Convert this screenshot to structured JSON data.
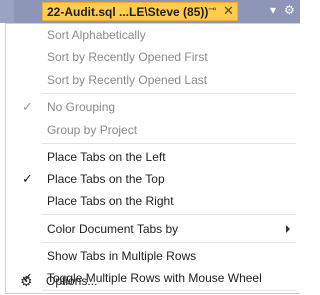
{
  "tab": {
    "title": "22-Audit.sql ...LE\\Steve (85))",
    "pin_icon": "pin-icon",
    "close_icon": "close-icon",
    "close_glyph": "✕",
    "pin_glyph": "⊸"
  },
  "toolbar": {
    "dropdown_icon": "dropdown-icon",
    "settings_icon": "gear-icon",
    "dropdown_glyph": "▾",
    "settings_glyph": "⚙"
  },
  "menu": {
    "sort_alphabetically": "Sort Alphabetically",
    "sort_recent_first": "Sort by Recently Opened First",
    "sort_recent_last": "Sort by Recently Opened Last",
    "no_grouping": "No Grouping",
    "group_by_project": "Group by Project",
    "tabs_left": "Place Tabs on the Left",
    "tabs_top": "Place Tabs on the Top",
    "tabs_right": "Place Tabs on the Right",
    "color_tabs_by": "Color Document Tabs by",
    "multiple_rows": "Show Tabs in Multiple Rows",
    "toggle_rows_wheel": "Toggle Multiple Rows with Mouse Wheel",
    "options": "Options...",
    "check_glyph": "✓",
    "gear_glyph": "⚙"
  },
  "colors": {
    "active_tab": "#ffcc4c",
    "tab_strip": "#8e96b8"
  }
}
